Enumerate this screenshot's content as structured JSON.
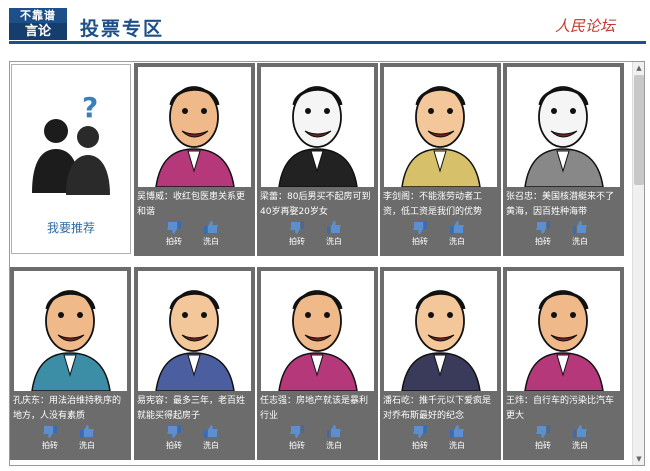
{
  "header": {
    "brand_line1": "不靠谱",
    "brand_line2": "言论",
    "title": "投票专区",
    "logo": "人民论坛"
  },
  "recommend": {
    "label": "我要推荐"
  },
  "vote_labels": {
    "down": "拍砖",
    "up": "洗白"
  },
  "cards": [
    {
      "caption": "吴博威：收红包医患关系更和谐"
    },
    {
      "caption": "梁蕾：80后男买不起房可到40岁再娶20岁女"
    },
    {
      "caption": "李剑阁：不能涨劳动者工资，低工资是我们的优势"
    },
    {
      "caption": "张召忠：美国核潜艇来不了黄海，因百姓种海带"
    },
    {
      "caption": "孔庆东：用法治维持秩序的地方，人没有素质"
    },
    {
      "caption": "易宪容：最多三年，老百姓就能买得起房子"
    },
    {
      "caption": "任志强：房地产就该是暴利行业"
    },
    {
      "caption": "潘石屹：推千元以下爱疯是对乔布斯最好的纪念"
    },
    {
      "caption": "王炜：自行车的污染比汽车更大"
    }
  ],
  "colors": {
    "brand": "#1d4f88",
    "card_bg": "#6c6c6c",
    "link": "#2d6aa6"
  }
}
